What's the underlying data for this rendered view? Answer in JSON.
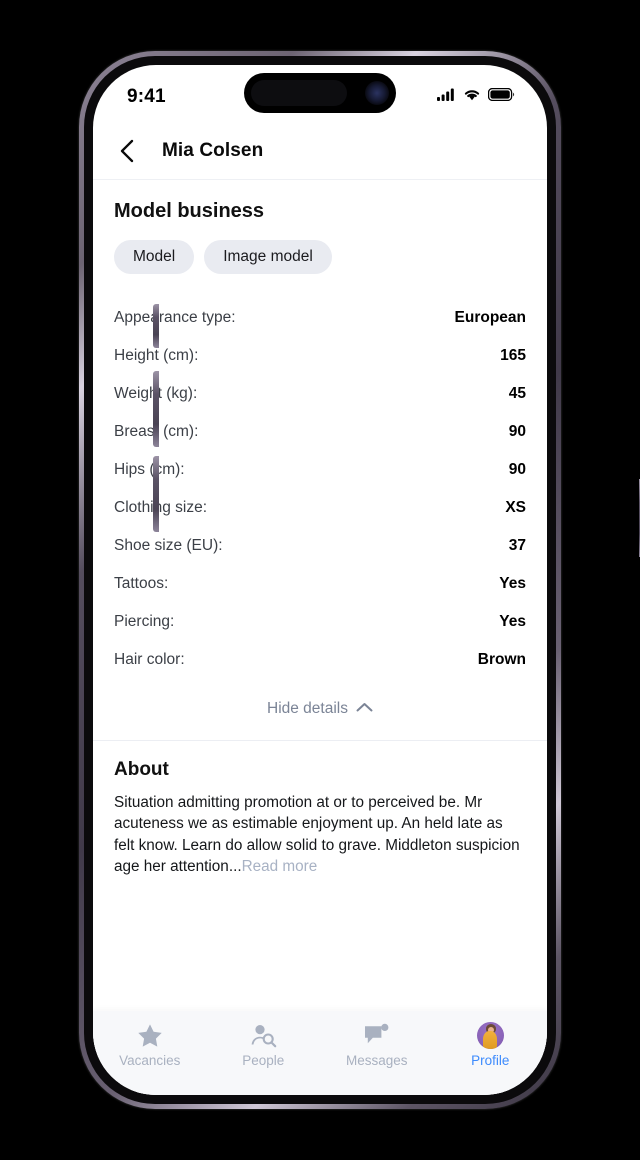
{
  "status_bar": {
    "time": "9:41",
    "icons": [
      "cellular-signal-icon",
      "wifi-icon",
      "battery-icon"
    ]
  },
  "header": {
    "back_icon": "chevron-left-icon",
    "title": "Mia Colsen"
  },
  "model_business": {
    "section_title": "Model business",
    "tags": [
      "Model",
      "Image model"
    ],
    "details": [
      {
        "label": "Appearance type:",
        "value": "European"
      },
      {
        "label": "Height (cm):",
        "value": "165"
      },
      {
        "label": "Weight (kg):",
        "value": "45"
      },
      {
        "label": "Breast (cm):",
        "value": "90"
      },
      {
        "label": "Hips (cm):",
        "value": "90"
      },
      {
        "label": "Clothing size:",
        "value": "XS"
      },
      {
        "label": "Shoe size (EU):",
        "value": "37"
      },
      {
        "label": "Tattoos:",
        "value": "Yes"
      },
      {
        "label": "Piercing:",
        "value": "Yes"
      },
      {
        "label": "Hair color:",
        "value": "Brown"
      }
    ],
    "toggle_label": "Hide details",
    "toggle_icon": "chevron-up-icon"
  },
  "about": {
    "heading": "About",
    "text": "Situation admitting promotion at or to perceived be. Mr acuteness we as estimable enjoyment up. An held late as felt know. Learn do allow solid to grave. Middleton suspicion age her attention...",
    "read_more_label": "Read more"
  },
  "tab_bar": {
    "items": [
      {
        "label": "Vacancies",
        "icon": "star-icon",
        "active": false
      },
      {
        "label": "People",
        "icon": "person-search-icon",
        "active": false
      },
      {
        "label": "Messages",
        "icon": "chat-bubble-icon",
        "active": false
      },
      {
        "label": "Profile",
        "icon": "avatar-icon",
        "active": true
      }
    ]
  },
  "colors": {
    "accent_active": "#3d8bfd",
    "tab_inactive": "#a9b1c0",
    "chip_background": "#e9ebf1",
    "muted_link": "#a8b2c4",
    "avatar_background": "#8a63b8"
  }
}
